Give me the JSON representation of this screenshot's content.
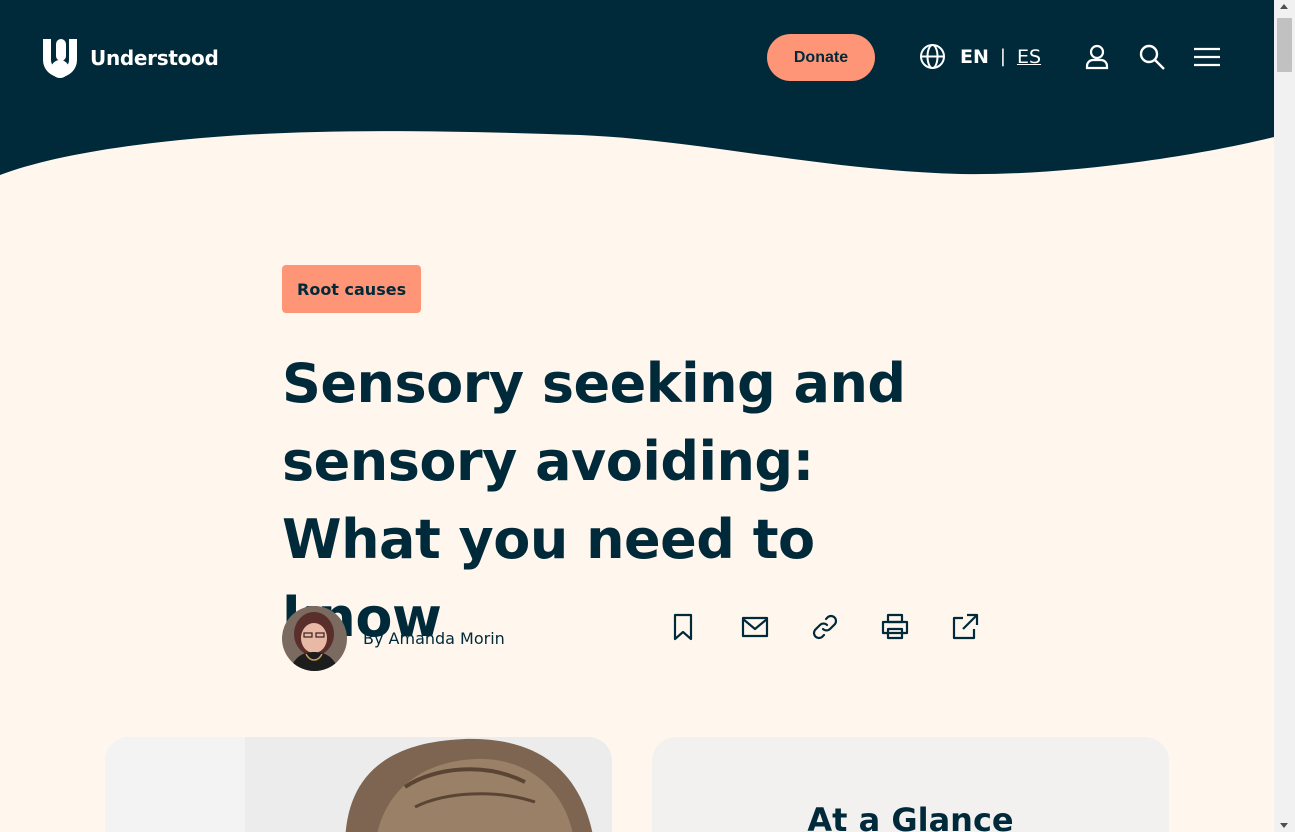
{
  "brand": {
    "name": "Understood"
  },
  "header": {
    "donate_label": "Donate",
    "lang_current": "EN",
    "lang_separator": "|",
    "lang_alt": "ES"
  },
  "icons": [
    "globe-icon",
    "user-icon",
    "search-icon",
    "menu-icon",
    "bookmark-icon",
    "email-icon",
    "link-icon",
    "print-icon",
    "external-share-icon"
  ],
  "colors": {
    "header_bg": "#002a3a",
    "page_bg": "#fff7ee",
    "accent": "#ff9577",
    "text": "#002a3a"
  },
  "article": {
    "tag": "Root causes",
    "title": "Sensory seeking and sensory avoiding: What you need to know",
    "author": "By Amanda Morin"
  },
  "sidebar": {
    "glance_title": "At a Glance"
  }
}
